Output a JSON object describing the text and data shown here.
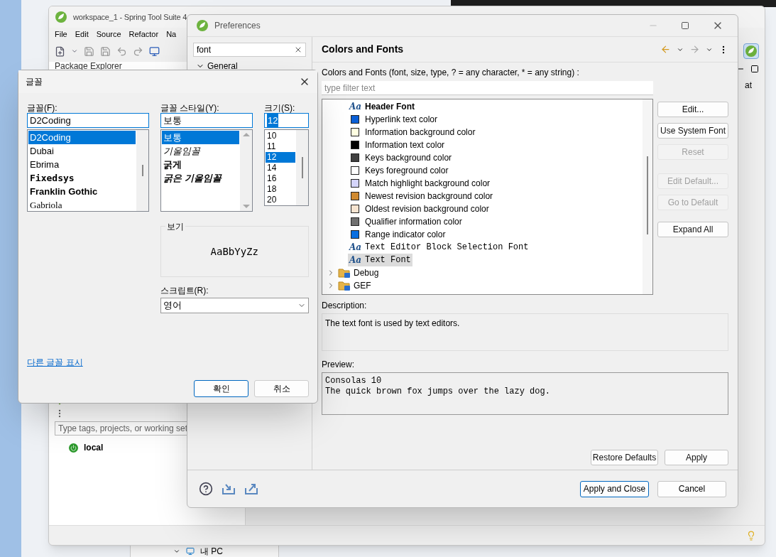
{
  "workspace": {
    "title": "workspace_1 - Spring Tool Suite 4",
    "menu": [
      "File",
      "Edit",
      "Source",
      "Refactor",
      "Na"
    ],
    "view_tab": "Package Explorer",
    "tag_filter": {
      "placeholder": "Type tags, projects, or working set"
    },
    "servers": [
      {
        "label": "local"
      }
    ],
    "side_text": "at"
  },
  "explorer_strip": {
    "label": "내 PC"
  },
  "preferences": {
    "title": "Preferences",
    "search": {
      "value": "font"
    },
    "nav_tree": [
      {
        "label": "General",
        "expanded": true
      }
    ],
    "page_title": "Colors and Fonts",
    "filter_label": "Colors and Fonts (font, size, type, ? = any character, * = any string) :",
    "filter": {
      "placeholder": "type filter text"
    },
    "items": [
      {
        "kind": "heading",
        "glyph": "Aa",
        "label": "Header Font",
        "selected": false
      },
      {
        "kind": "color",
        "label": "Hyperlink text color",
        "color": "#0a5fd6",
        "selected": false
      },
      {
        "kind": "color",
        "label": "Information background color",
        "color": "#ffffe1",
        "selected": false
      },
      {
        "kind": "color",
        "label": "Information text color",
        "color": "#000000",
        "selected": false
      },
      {
        "kind": "color",
        "label": "Keys background color",
        "color": "#404040",
        "selected": false
      },
      {
        "kind": "color",
        "label": "Keys foreground color",
        "color": "#ffffff",
        "selected": false
      },
      {
        "kind": "color",
        "label": "Match highlight background color",
        "color": "#d4d4fa",
        "selected": false
      },
      {
        "kind": "color",
        "label": "Newest revision background color",
        "color": "#d08a30",
        "selected": false
      },
      {
        "kind": "color",
        "label": "Oldest revision background color",
        "color": "#f6e4d0",
        "selected": false
      },
      {
        "kind": "color",
        "label": "Qualifier information color",
        "color": "#707070",
        "selected": false
      },
      {
        "kind": "color",
        "label": "Range indicator color",
        "color": "#0a6fe0",
        "selected": false
      },
      {
        "kind": "font",
        "glyph": "Aa",
        "label": "Text Editor Block Selection Font",
        "selected": false
      },
      {
        "kind": "font",
        "glyph": "Aa",
        "label": "Text Font",
        "selected": true
      },
      {
        "kind": "category",
        "label": "Debug",
        "expanded": false
      },
      {
        "kind": "category",
        "label": "GEF",
        "expanded": false
      }
    ],
    "side_buttons": [
      {
        "label": "Edit...",
        "disabled": false
      },
      {
        "label": "Use System Font",
        "disabled": false
      },
      {
        "label": "Reset",
        "disabled": true
      },
      {
        "label": "Edit Default...",
        "disabled": true
      },
      {
        "label": "Go to Default",
        "disabled": true
      },
      {
        "label": "Expand All",
        "disabled": false
      }
    ],
    "description_label": "Description:",
    "description": "The text font is used by text editors.",
    "preview_label": "Preview:",
    "preview_lines": [
      "Consolas 10",
      "The quick brown fox jumps over the lazy dog."
    ],
    "page_buttons": [
      "Restore Defaults",
      "Apply"
    ],
    "dialog_buttons": [
      {
        "label": "Apply and Close",
        "default": true
      },
      {
        "label": "Cancel",
        "default": false
      }
    ]
  },
  "font_dialog": {
    "title": "글꼴",
    "font": {
      "label": "글꼴(F):",
      "value": "D2Coding",
      "options": [
        {
          "label": "D2Coding",
          "kind": "plain",
          "selected": true
        },
        {
          "label": "Dubai",
          "kind": "plain",
          "selected": false
        },
        {
          "label": "Ebrima",
          "kind": "plain",
          "selected": false
        },
        {
          "label": "Fixedsys",
          "kind": "mono_bold",
          "selected": false
        },
        {
          "label": "Franklin Gothic",
          "kind": "bold",
          "selected": false
        },
        {
          "label": "Gabriola",
          "kind": "script",
          "selected": false
        }
      ]
    },
    "style": {
      "label": "글꼴 스타일(Y):",
      "value": "보통",
      "options": [
        {
          "label": "보통",
          "kind": "regular",
          "selected": true
        },
        {
          "label": "기울임꼴",
          "kind": "italic",
          "selected": false
        },
        {
          "label": "굵게",
          "kind": "bold",
          "selected": false
        },
        {
          "label": "굵은 기울임꼴",
          "kind": "bold_italic",
          "selected": false
        }
      ]
    },
    "size": {
      "label": "크기(S):",
      "value": "12",
      "options": [
        {
          "label": "10",
          "selected": false
        },
        {
          "label": "11",
          "selected": false
        },
        {
          "label": "12",
          "selected": true
        },
        {
          "label": "14",
          "selected": false
        },
        {
          "label": "16",
          "selected": false
        },
        {
          "label": "18",
          "selected": false
        },
        {
          "label": "20",
          "selected": false
        }
      ]
    },
    "sample_label": "보기",
    "sample_text": "AaBbYyZz",
    "script": {
      "label": "스크립트(R):",
      "value": "영어"
    },
    "more_fonts_link": "다른 글꼴 표시",
    "buttons": [
      {
        "label": "확인",
        "default": true
      },
      {
        "label": "취소",
        "default": false
      }
    ]
  }
}
